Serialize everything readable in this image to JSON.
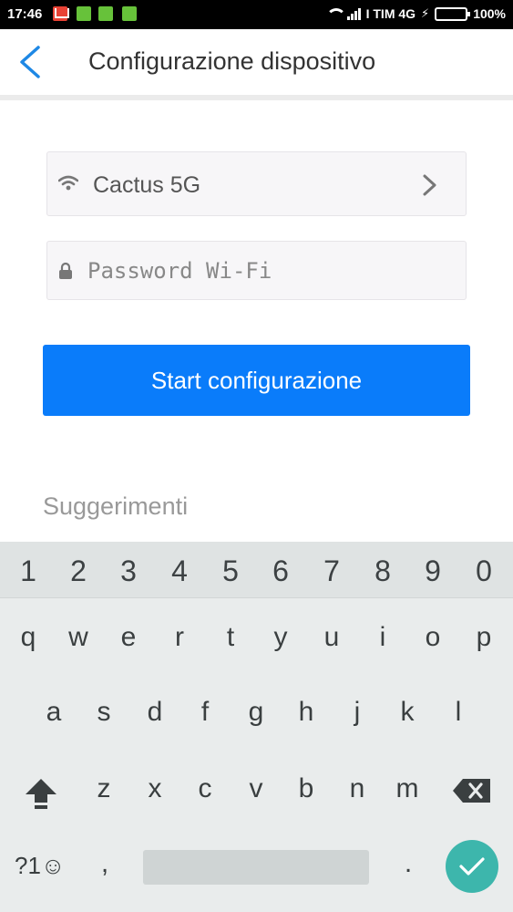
{
  "status_bar": {
    "time": "17:46",
    "carrier": "I TIM 4G",
    "battery": "100%"
  },
  "header": {
    "title": "Configurazione dispositivo"
  },
  "form": {
    "ssid": "Cactus 5G",
    "password_placeholder": "Password Wi-Fi",
    "start_button": "Start configurazione"
  },
  "suggestions_title": "Suggerimenti",
  "keyboard": {
    "numbers": [
      "1",
      "2",
      "3",
      "4",
      "5",
      "6",
      "7",
      "8",
      "9",
      "0"
    ],
    "row1": [
      "q",
      "w",
      "e",
      "r",
      "t",
      "y",
      "u",
      "i",
      "o",
      "p"
    ],
    "row2": [
      "a",
      "s",
      "d",
      "f",
      "g",
      "h",
      "j",
      "k",
      "l"
    ],
    "row3": [
      "z",
      "x",
      "c",
      "v",
      "b",
      "n",
      "m"
    ],
    "symbols_key": "?1☺",
    "comma": ",",
    "period": "."
  },
  "colors": {
    "accent": "#0a7cfa",
    "back_arrow": "#1e88e5",
    "ok_key": "#3db6ac"
  }
}
